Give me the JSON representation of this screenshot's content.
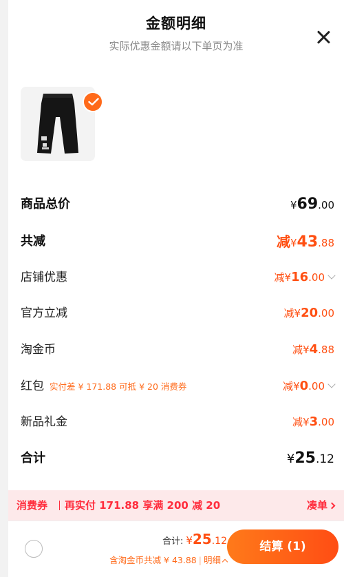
{
  "header": {
    "title": "金额明细",
    "subtitle": "实际优惠金额请以下单页为准"
  },
  "rows": {
    "total_price": {
      "label": "商品总价",
      "currency": "¥",
      "integer": "69",
      "decimal": ".00"
    },
    "total_discount": {
      "label": "共减",
      "prefix": "减",
      "currency": "¥",
      "integer": "43",
      "decimal": ".88"
    },
    "store_discount": {
      "label": "店铺优惠",
      "prefix": "减",
      "currency": "¥",
      "integer": "16",
      "decimal": ".00"
    },
    "official_discount": {
      "label": "官方立减",
      "prefix": "减",
      "currency": "¥",
      "integer": "20",
      "decimal": ".00"
    },
    "taojinbi": {
      "label": "淘金币",
      "prefix": "减",
      "currency": "¥",
      "integer": "4",
      "decimal": ".88"
    },
    "red_packet": {
      "label": "红包",
      "hint": "实付差 ¥ 171.88 可抵 ¥ 20 消费券",
      "prefix": "减",
      "currency": "¥",
      "integer": "0",
      "decimal": ".00"
    },
    "new_gift": {
      "label": "新品礼金",
      "prefix": "减",
      "currency": "¥",
      "integer": "3",
      "decimal": ".00"
    },
    "subtotal": {
      "label": "合计",
      "currency": "¥",
      "integer": "25",
      "decimal": ".12"
    }
  },
  "coupon_bar": {
    "tag": "消费券",
    "text": "再实付 171.88 享满 200 减 20",
    "link": "凑单"
  },
  "footer": {
    "total_label": "合计:",
    "currency": "¥",
    "amount_integer": "25",
    "amount_decimal": ".12",
    "sub_text": "含淘金币共减 ¥ 43.88",
    "detail_link": "明细",
    "checkout_label": "结算 (1)"
  },
  "colors": {
    "accent": "#ff4f12",
    "coupon_red": "#ff2d3d",
    "coupon_bg": "#fde9ea"
  }
}
